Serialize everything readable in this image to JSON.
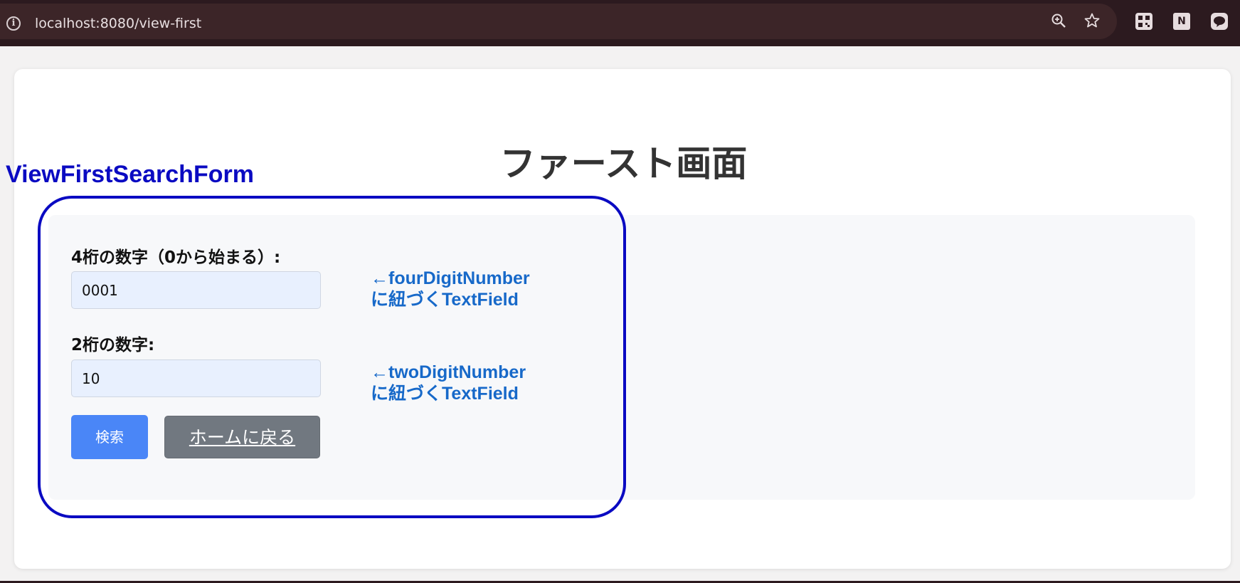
{
  "browser": {
    "url": "localhost:8080/view-first"
  },
  "page": {
    "title": "ファースト画面"
  },
  "form": {
    "four_digit_label": "4桁の数字（0から始まる）:",
    "four_digit_value": "0001",
    "two_digit_label": "2桁の数字:",
    "two_digit_value": "10",
    "search_button": "検索",
    "home_button": "ホームに戻る"
  },
  "annotations": {
    "form_name": "ViewFirstSearchForm",
    "four_digit_note_line1": "←fourDigitNumber",
    "four_digit_note_line2": "に紐づくTextField",
    "two_digit_note_line1": "←twoDigitNumber",
    "two_digit_note_line2": "に紐づくTextField"
  },
  "icons": {
    "info": "info-icon",
    "zoom": "zoom-icon",
    "bookmark": "star-icon",
    "qr": "qr-code-icon",
    "notion": "notion-icon",
    "line": "line-icon"
  },
  "colors": {
    "annotation_blue": "#0a0ac2",
    "note_blue": "#1769c9",
    "search_button": "#4a86f7",
    "home_button": "#717880",
    "input_bg": "#e8f0fe"
  }
}
